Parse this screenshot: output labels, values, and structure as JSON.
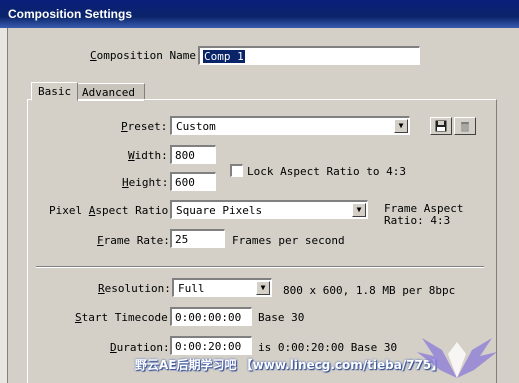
{
  "window": {
    "title": "Composition Settings"
  },
  "composition_name": {
    "label": "Composition Name:",
    "value": "Comp 1"
  },
  "tabs": [
    {
      "label": "Basic"
    },
    {
      "label": "Advanced"
    }
  ],
  "preset": {
    "label": "Preset:",
    "value": "Custom"
  },
  "width": {
    "label": "Width:",
    "value": "800"
  },
  "height": {
    "label": "Height:",
    "value": "600"
  },
  "lock_aspect": {
    "label": "Lock Aspect Ratio to 4:3",
    "checked": false
  },
  "pixel_aspect": {
    "label": "Pixel Aspect Ratio:",
    "value": "Square Pixels"
  },
  "frame_aspect": {
    "line1": "Frame Aspect",
    "line2": "Ratio: 4:3"
  },
  "frame_rate": {
    "label": "Frame Rate:",
    "value": "25",
    "unit": "Frames per second"
  },
  "resolution": {
    "label": "Resolution:",
    "value": "Full",
    "info": "800 x 600, 1.8 MB per 8bpc"
  },
  "start_timecode": {
    "label": "Start Timecode:",
    "value": "0:00:00:00",
    "base": "Base 30"
  },
  "duration": {
    "label": "Duration:",
    "value": "0:00:20:00",
    "info": "is 0:00:20:00  Base 30"
  },
  "watermark": {
    "text": "野云AE后期学习吧 【www.linecg.com/tieba/775】"
  },
  "icons": {
    "save": "floppy-disk-icon",
    "delete": "trash-icon"
  }
}
